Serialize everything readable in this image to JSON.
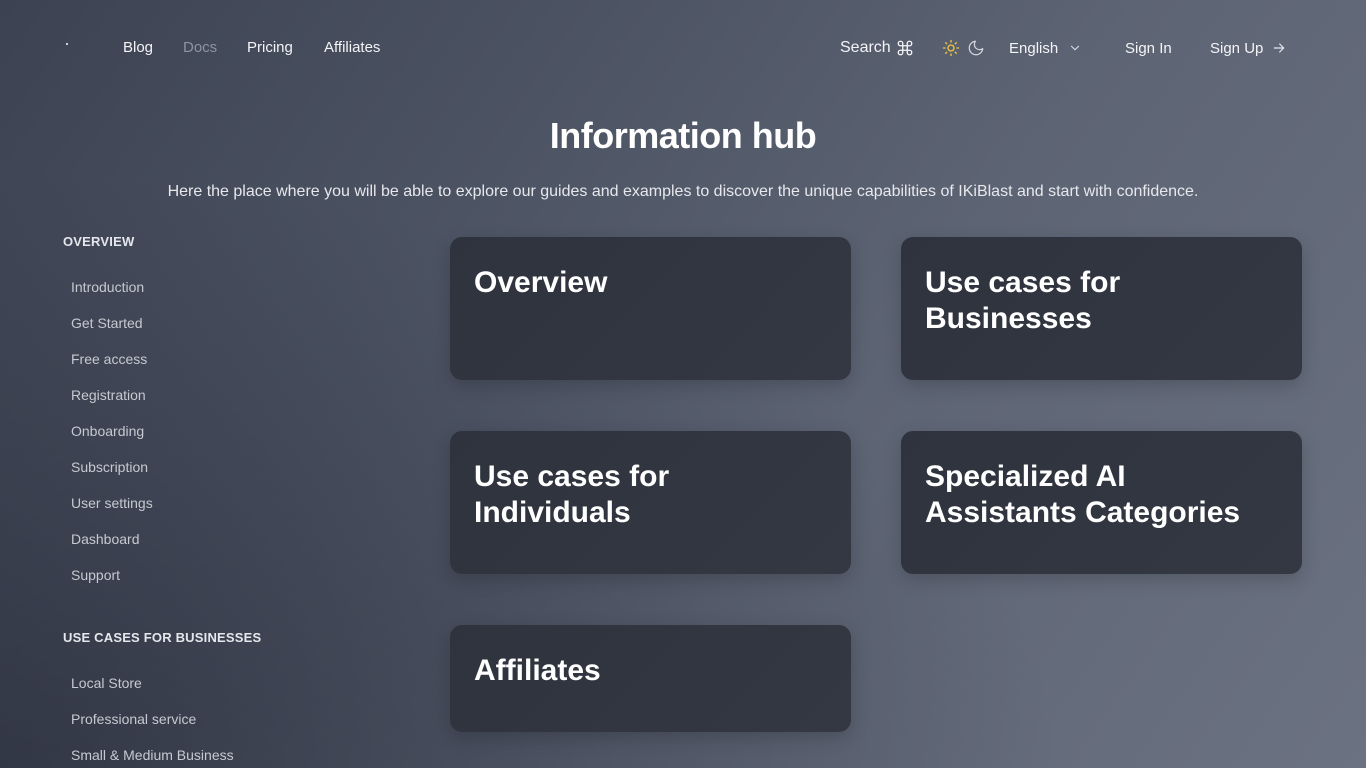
{
  "header": {
    "nav": [
      "Blog",
      "Docs",
      "Pricing",
      "Affiliates"
    ],
    "search_label": "Search",
    "search_icon": "command-icon",
    "theme_icons": [
      "sun-icon",
      "moon-icon"
    ],
    "language": "English",
    "sign_in": "Sign In",
    "sign_up": "Sign Up",
    "accent_sun": "#f5c542"
  },
  "hero": {
    "title": "Information hub",
    "subtitle": "Here the place where you will be able to explore our guides and examples to discover the unique capabilities of IKiBlast and start with confidence."
  },
  "sidebar": {
    "sections": [
      {
        "heading": "OVERVIEW",
        "items": [
          "Introduction",
          "Get Started",
          "Free access",
          "Registration",
          "Onboarding",
          "Subscription",
          "User settings",
          "Dashboard",
          "Support"
        ]
      },
      {
        "heading": "USE CASES FOR BUSINESSES",
        "items": [
          "Local Store",
          "Professional service",
          "Small & Medium Business"
        ]
      }
    ]
  },
  "cards": [
    "Overview",
    "Use cases for Businesses",
    "Use cases for Individuals",
    "Specialized AI Assistants Categories",
    "Affiliates"
  ]
}
